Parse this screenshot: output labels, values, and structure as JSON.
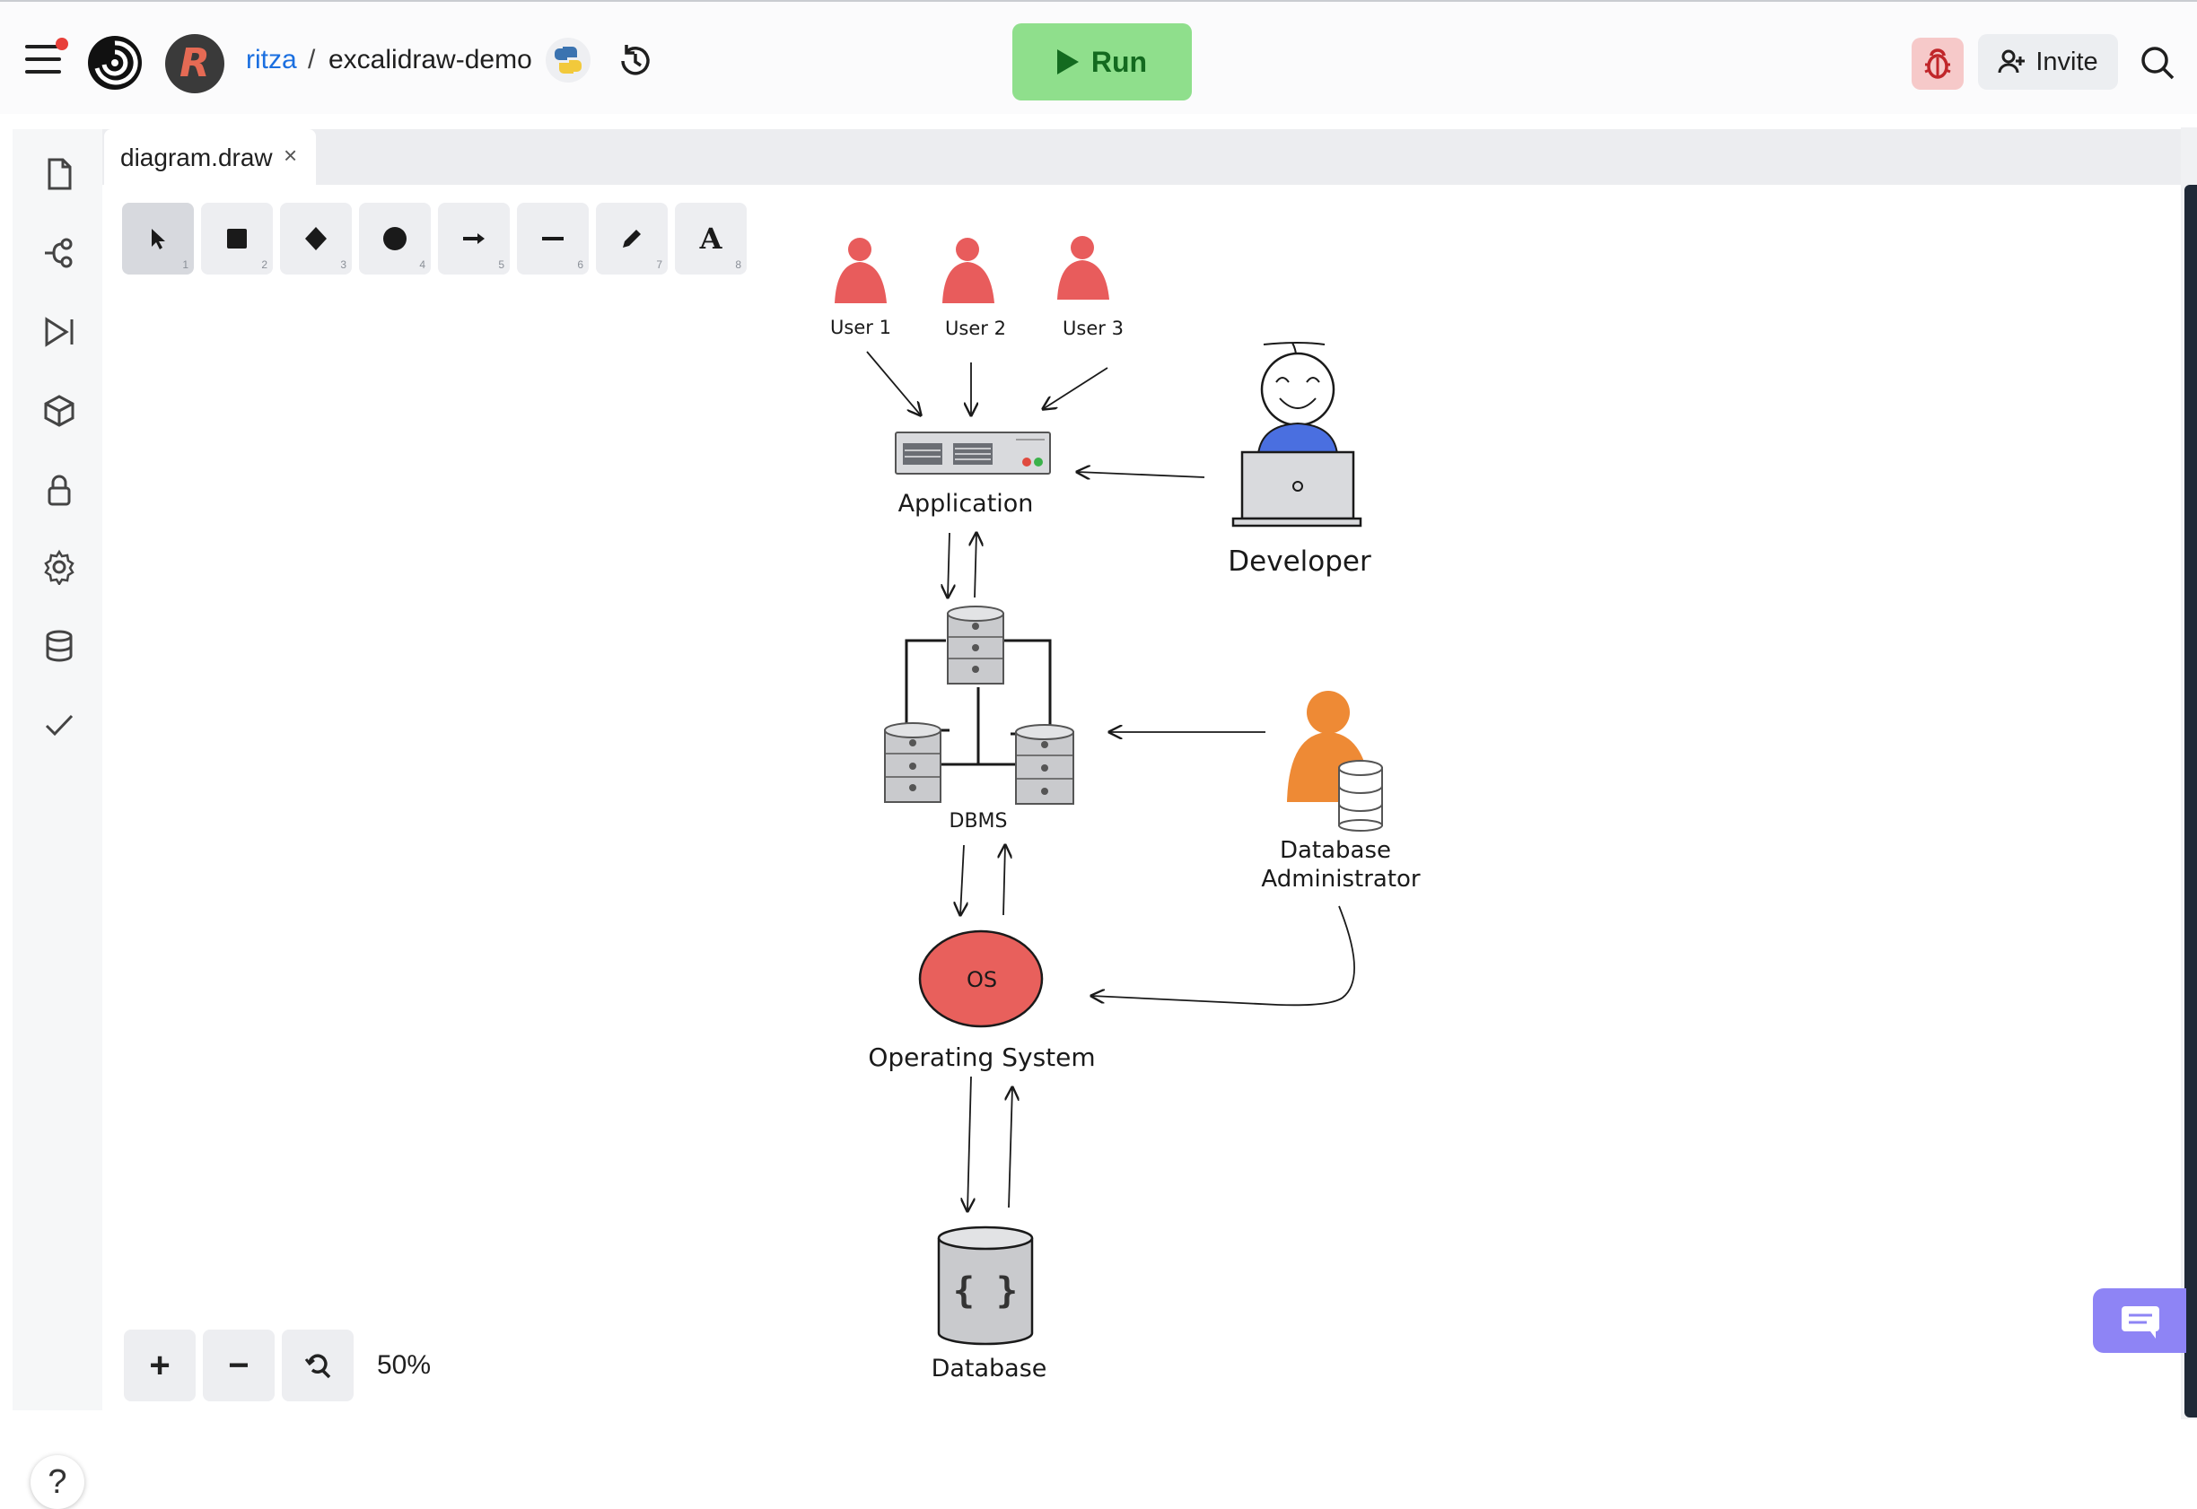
{
  "header": {
    "user": "ritza",
    "separator": "/",
    "repl_name": "excalidraw-demo",
    "run_label": "Run",
    "invite_label": "Invite",
    "avatar_letter": "R"
  },
  "tab": {
    "label": "diagram.draw",
    "close": "×"
  },
  "toolbar": {
    "tools": [
      {
        "name": "selection",
        "key": "1"
      },
      {
        "name": "rectangle",
        "key": "2"
      },
      {
        "name": "diamond",
        "key": "3"
      },
      {
        "name": "ellipse",
        "key": "4"
      },
      {
        "name": "arrow",
        "key": "5"
      },
      {
        "name": "line",
        "key": "6"
      },
      {
        "name": "draw",
        "key": "7"
      },
      {
        "name": "text",
        "key": "8",
        "glyph": "A"
      }
    ]
  },
  "zoom": {
    "plus": "+",
    "minus": "−",
    "level": "50%"
  },
  "help": "?",
  "diagram": {
    "users": [
      "User 1",
      "User 2",
      "User 3"
    ],
    "application": "Application",
    "developer": "Developer",
    "dbms": "DBMS",
    "dba_line1": "Database",
    "dba_line2": "Administrator",
    "os_short": "OS",
    "os": "Operating System",
    "database": "Database",
    "db_glyph": "{ }"
  },
  "colors": {
    "user_red": "#e85c5c",
    "os_red": "#e8605c",
    "dba_orange": "#ee8a35",
    "dev_blue": "#4a6fe0",
    "run_green": "#8fdf8c",
    "accent_purple": "#8e84f5"
  }
}
